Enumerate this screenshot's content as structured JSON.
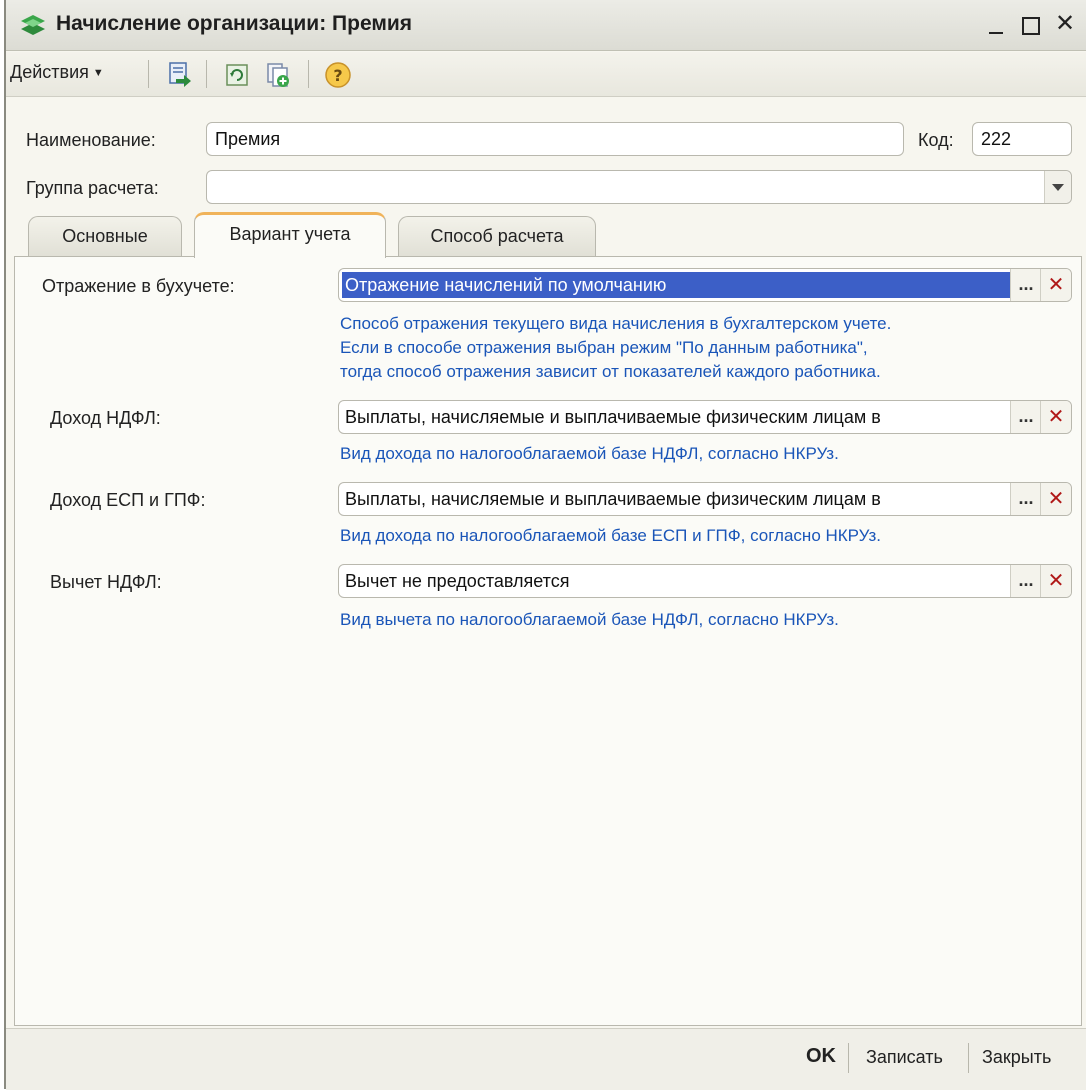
{
  "window": {
    "title": "Начисление организации: Премия",
    "close_glyph": "✕"
  },
  "toolbar": {
    "actions_label": "Действия",
    "icons": [
      "save-to-list-icon",
      "refresh-icon",
      "copy-new-icon",
      "help-icon"
    ],
    "help_glyph": "?"
  },
  "form": {
    "name_label": "Наименование:",
    "name_value": "Премия",
    "code_label": "Код:",
    "code_value": "222",
    "group_label": "Группа расчета:",
    "group_value": ""
  },
  "tabs": [
    {
      "label": "Основные",
      "active": false
    },
    {
      "label": "Вариант учета",
      "active": true
    },
    {
      "label": "Способ расчета",
      "active": false
    }
  ],
  "panel": {
    "accounting": {
      "label": "Отражение в бухучете:",
      "value": "Отражение начислений по умолчанию",
      "hint_lines": [
        "Способ отражения текущего вида начисления в бухгалтерском учете.",
        "Если в способе отражения выбран режим \"По данным работника\",",
        "тогда способ отражения зависит от показателей каждого работника."
      ]
    },
    "ndfl_income": {
      "label": "Доход НДФЛ:",
      "value": "Выплаты, начисляемые и выплачиваемые физическим лицам в",
      "hint": "Вид дохода по налогооблагаемой базе НДФЛ, согласно НКРУз."
    },
    "esp_income": {
      "label": "Доход ЕСП и ГПФ:",
      "value": "Выплаты, начисляемые и выплачиваемые физическим лицам в",
      "hint": "Вид дохода по налогооблагаемой базе ЕСП и ГПФ, согласно НКРУз."
    },
    "ndfl_deduction": {
      "label": "Вычет НДФЛ:",
      "value": "Вычет не предоставляется",
      "hint": "Вид вычета по налогооблагаемой базе НДФЛ, согласно НКРУз."
    },
    "select_glyph": "...",
    "clear_glyph": "✕"
  },
  "bottom": {
    "ok": "OK",
    "save": "Записать",
    "close": "Закрыть"
  },
  "colors": {
    "selection": "#3c5fc7",
    "hint_text": "#1a55b8",
    "active_tab_accent": "#f0b35a",
    "clear_button": "#b01818"
  }
}
